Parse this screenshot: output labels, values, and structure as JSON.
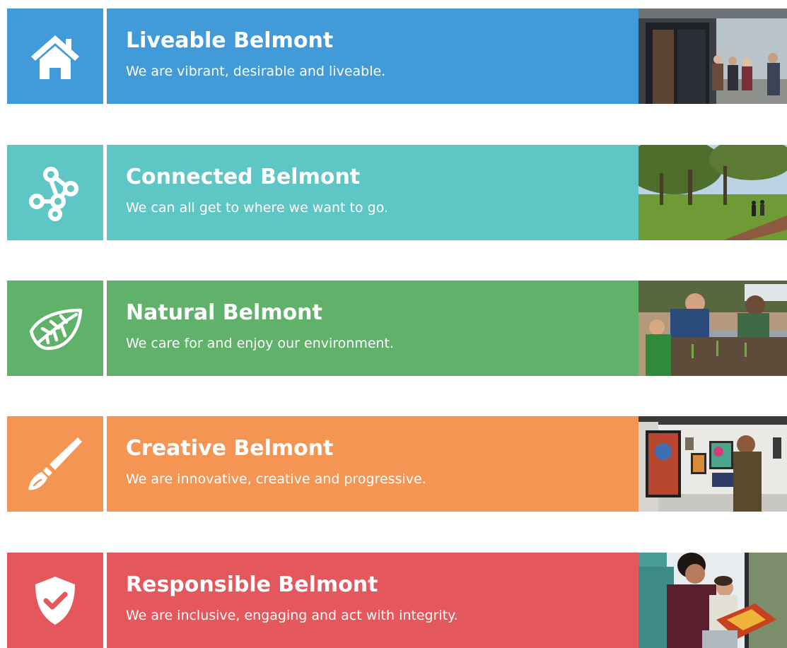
{
  "rows": [
    {
      "title": "Liveable Belmont",
      "subtitle": "We are vibrant, desirable and liveable.",
      "color": "#419bd8",
      "icon": "house-icon",
      "photo": "people-walking-outside-building-photo"
    },
    {
      "title": "Connected Belmont",
      "subtitle": "We can all get to where we want to go.",
      "color": "#5ec6c5",
      "icon": "network-nodes-icon",
      "photo": "park-path-trees-photo"
    },
    {
      "title": "Natural Belmont",
      "subtitle": "We care for and enjoy our environment.",
      "color": "#60b26a",
      "icon": "leaf-icon",
      "photo": "family-gardening-photo"
    },
    {
      "title": "Creative Belmont",
      "subtitle": "We are innovative, creative and progressive.",
      "color": "#f59553",
      "icon": "paintbrush-icon",
      "photo": "art-gallery-visitor-photo"
    },
    {
      "title": "Responsible Belmont",
      "subtitle": "We are inclusive, engaging and act with integrity.",
      "color": "#e4585d",
      "icon": "shield-check-icon",
      "photo": "woman-reading-to-child-photo"
    }
  ]
}
